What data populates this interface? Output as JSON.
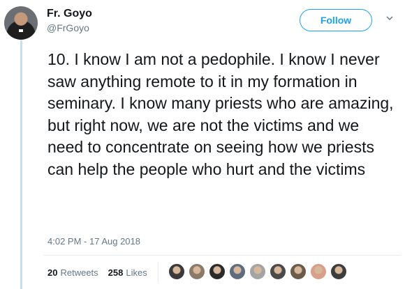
{
  "author": {
    "name": "Fr. Goyo",
    "handle": "@FrGoyo"
  },
  "follow_label": "Follow",
  "tweet": {
    "text": "10. I know I am not a pedophile. I know I never saw anything remote to it in my formation in seminary. I know many priests who are amazing, but right now, we are not the victims and we need to concentrate on seeing how we priests can help the people who hurt and the victims",
    "timestamp": "4:02 PM - 17 Aug 2018"
  },
  "stats": {
    "retweets_count": "20",
    "retweets_label": "Retweets",
    "likes_count": "258",
    "likes_label": "Likes"
  },
  "likers": [
    {
      "color": "#3a3a3a"
    },
    {
      "color": "#8a7a6a"
    },
    {
      "color": "#2b2b2b"
    },
    {
      "color": "#5d6d7e"
    },
    {
      "color": "#a4a4a4"
    },
    {
      "color": "#4a4a4a"
    },
    {
      "color": "#6b5b4b"
    },
    {
      "color": "#d9a089"
    },
    {
      "color": "#3d3d3d"
    }
  ],
  "colors": {
    "accent": "#1da1f2",
    "secondary_text": "#657786",
    "thread_line": "#c4e1ef"
  }
}
